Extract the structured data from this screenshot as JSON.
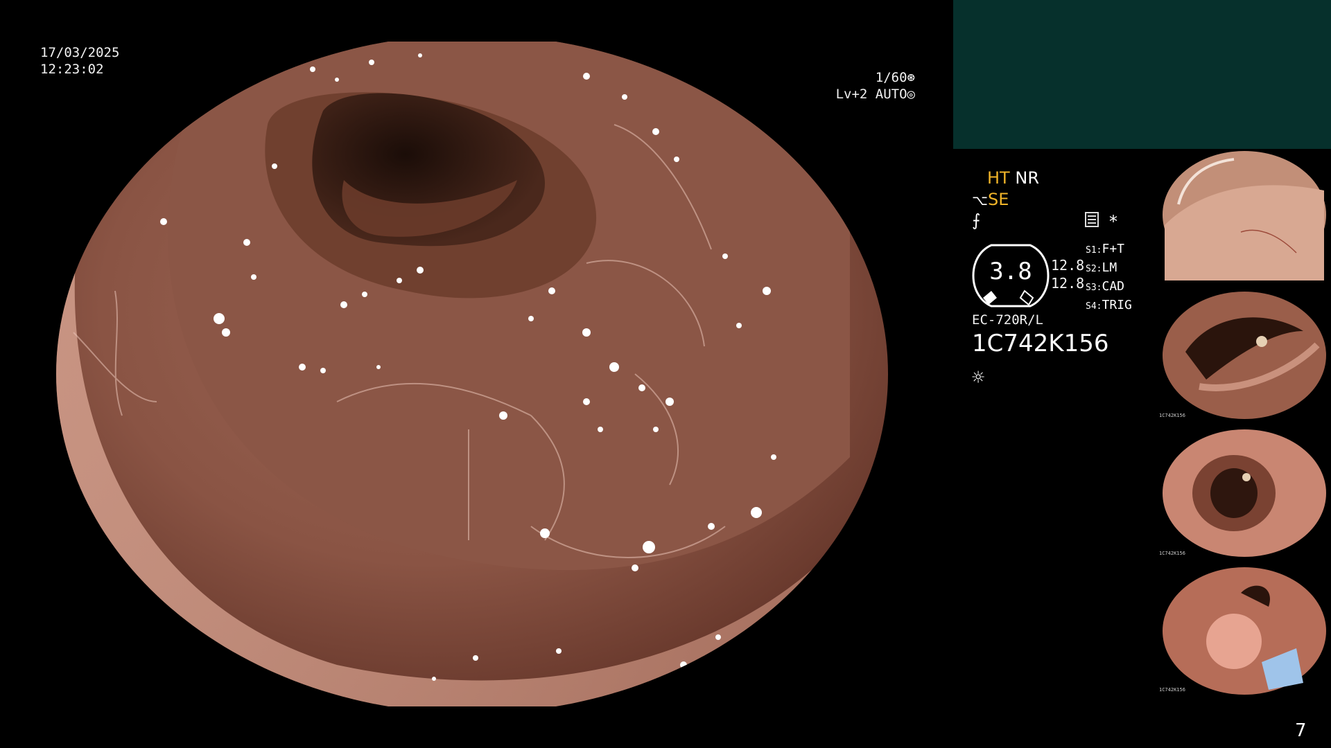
{
  "osd": {
    "date": "17/03/2025",
    "time": "12:23:02",
    "shutter": "1/60",
    "level": "Lv+2",
    "iris_mode": "AUTO"
  },
  "modes": {
    "ht": "HT",
    "nr": "NR",
    "se": "SE",
    "asterisk": "*"
  },
  "gauge": {
    "value": "3.8",
    "side_top": "12.8",
    "side_bottom": "12.8"
  },
  "scope_keys": [
    {
      "key": "S1",
      "value": "F+T"
    },
    {
      "key": "S2",
      "value": "LM"
    },
    {
      "key": "S3",
      "value": "CAD"
    },
    {
      "key": "S4",
      "value": "TRIG"
    }
  ],
  "device": {
    "model": "EC-720R/L",
    "serial": "1C742K156"
  },
  "thumbnails": [
    {
      "serial": "1C742K156",
      "scene": "mucosa"
    },
    {
      "serial": "1C742K156",
      "scene": "lumen"
    },
    {
      "serial": "1C742K156",
      "scene": "lumen-small"
    },
    {
      "serial": "1C742K156",
      "scene": "polyp-snare"
    }
  ],
  "page_number": "7",
  "colors": {
    "background": "#000000",
    "panel": "#06302c",
    "accent": "#f0b429",
    "tissue": "#a8705c"
  },
  "icons": [
    "shutter-icon",
    "iris-icon",
    "se-icon",
    "enhance-icon",
    "record-icon",
    "light-icon"
  ]
}
